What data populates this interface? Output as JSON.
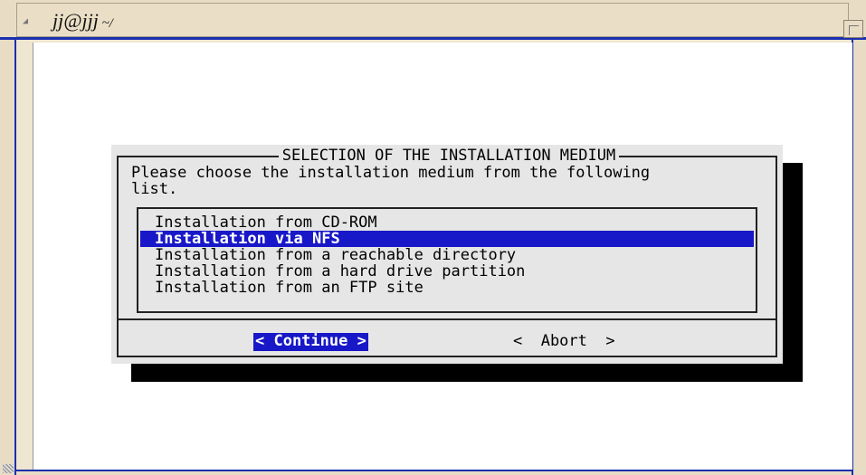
{
  "window": {
    "title_main": "jj@jjj",
    "title_suffix": " ~/"
  },
  "dialog": {
    "title": "SELECTION OF THE INSTALLATION MEDIUM",
    "prompt": "Please choose the installation medium from the following\nlist.",
    "items": [
      {
        "label": "Installation from CD-ROM",
        "selected": false
      },
      {
        "label": "Installation via NFS",
        "selected": true
      },
      {
        "label": "Installation from a reachable directory",
        "selected": false
      },
      {
        "label": "Installation from a hard drive partition",
        "selected": false
      },
      {
        "label": "Installation from an FTP site",
        "selected": false
      }
    ],
    "buttons": {
      "continue": "< Continue >",
      "abort": "<  Abort  >"
    }
  },
  "colors": {
    "selection": "#1818c8",
    "dialog_bg": "#e6e6e6",
    "frame_border": "#1b2fb0"
  }
}
